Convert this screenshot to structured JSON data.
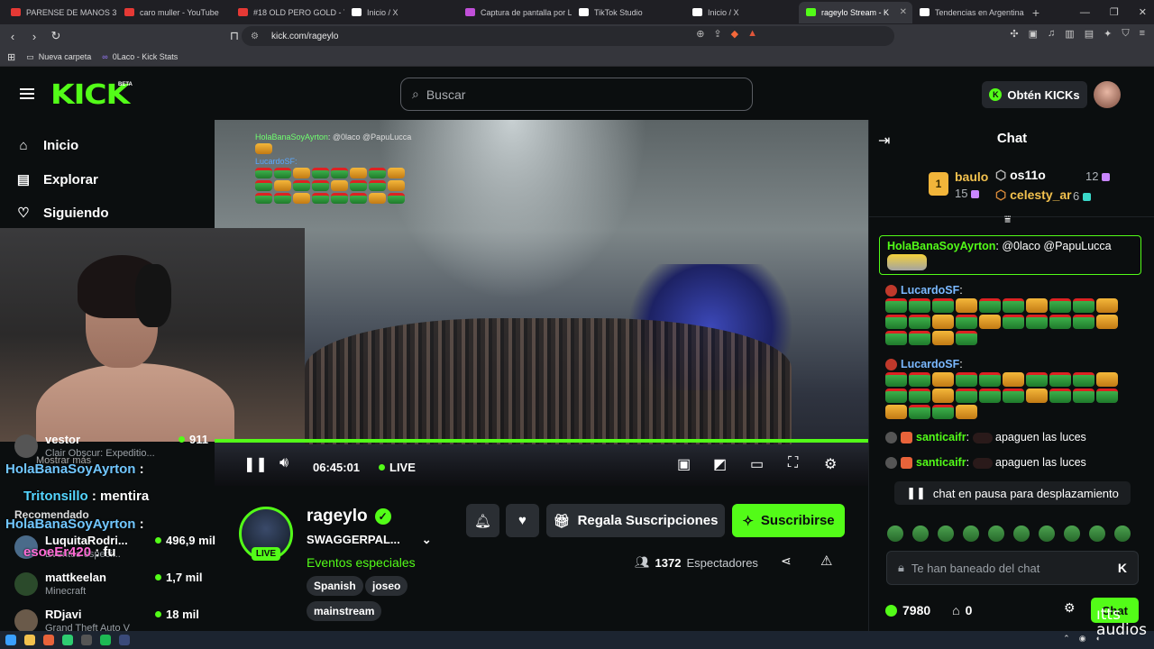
{
  "browser": {
    "tabs": [
      {
        "title": "PARENSE DE MANOS 3 - E",
        "fav": "#e53935"
      },
      {
        "title": "caro muller - YouTube",
        "fav": "#e53935"
      },
      {
        "title": "#18 OLD PERO GOLD - Yo",
        "fav": "#e53935"
      },
      {
        "title": "Inicio / X",
        "fav": "#ffffff"
      },
      {
        "title": "Captura de pantalla por Li",
        "fav": "#c04fd8"
      },
      {
        "title": "TikTok Studio",
        "fav": "#ffffff"
      },
      {
        "title": "Inicio / X",
        "fav": "#ffffff"
      },
      {
        "title": "rageylo Stream - K",
        "fav": "#53fc18",
        "active": true
      },
      {
        "title": "Tendencias en Argentina",
        "fav": "#ffffff"
      }
    ],
    "url": "kick.com/rageylo",
    "bookmarks": [
      "Nueva carpeta",
      "0Laco - Kick Stats"
    ]
  },
  "header": {
    "logo": "KICK",
    "beta": "BETA",
    "search_placeholder": "Buscar",
    "get_kicks": "Obtén KICKs"
  },
  "sidebar": {
    "nav": [
      "Inicio",
      "Explorar",
      "Siguiendo"
    ],
    "recommended_label": "Recomendado",
    "show_more": "Mostrar más",
    "items": [
      {
        "name": "vestor",
        "category": "Clair Obscur: Expeditio...",
        "viewers": "911"
      },
      {
        "name": "LuquitaRodri...",
        "category": "Eventos especi...",
        "viewers": "496,9 mil"
      },
      {
        "name": "mattkeelan",
        "category": "Minecraft",
        "viewers": "1,7 mil"
      },
      {
        "name": "RDjavi",
        "category": "Grand Theft Auto V",
        "viewers": "18 mil"
      }
    ],
    "overlay_chat": [
      {
        "user": "HolaBanaSoyAyrton",
        "text": ":"
      },
      {
        "user": "Tritonsillo",
        "text": ": mentira"
      },
      {
        "user": "HolaBanaSoyAyrton",
        "text": ":"
      },
      {
        "user": "esoeEr420",
        "text": ": fu"
      }
    ]
  },
  "video": {
    "overlay_user1": "HolaBanaSoyAyrton",
    "overlay_text1": ": @0laco @PapuLucca",
    "overlay_user2": "LucardoSF:",
    "time": "06:45:01",
    "live": "LIVE",
    "progress": 1.0
  },
  "channel": {
    "name": "rageylo",
    "live_tag": "LIVE",
    "title": "SWAGGERPAL...",
    "category": "Eventos especiales",
    "tags": [
      "Spanish",
      "joseo",
      "mainstream"
    ],
    "gift_label": "Regala Suscripciones",
    "subscribe_label": "Suscribirse",
    "viewers_count": "1372",
    "viewers_label": "Espectadores"
  },
  "chat": {
    "title": "Chat",
    "leaderboard": [
      {
        "rank": "1",
        "name": "baulo",
        "count": "15"
      },
      {
        "rank": "2",
        "name": "os11o",
        "count": "12"
      },
      {
        "rank": "3",
        "name": "celesty_ar",
        "count": "6"
      }
    ],
    "pinned_user": "HolaBanaSoyAyrton",
    "pinned_text": ": @0laco @PapuLucca",
    "messages": [
      {
        "user": "LucardoSF",
        "text": ":"
      },
      {
        "user": "LucardoSF",
        "text": ":"
      },
      {
        "user": "santicaifr",
        "text": "apaguen las luces"
      },
      {
        "user": "santicaifr",
        "text": "apaguen las luces"
      }
    ],
    "paused": "chat en pausa para desplazamiento",
    "input_placeholder": "Te han baneado del chat",
    "kicks": "7980",
    "shop_count": "0",
    "send_label": "Chat",
    "colors": {
      "pinned_user": "#53fc18",
      "lucardo": "#7ab8ff",
      "santicaifr": "#53fc18"
    }
  },
  "watermark": "ıtts\naudios"
}
